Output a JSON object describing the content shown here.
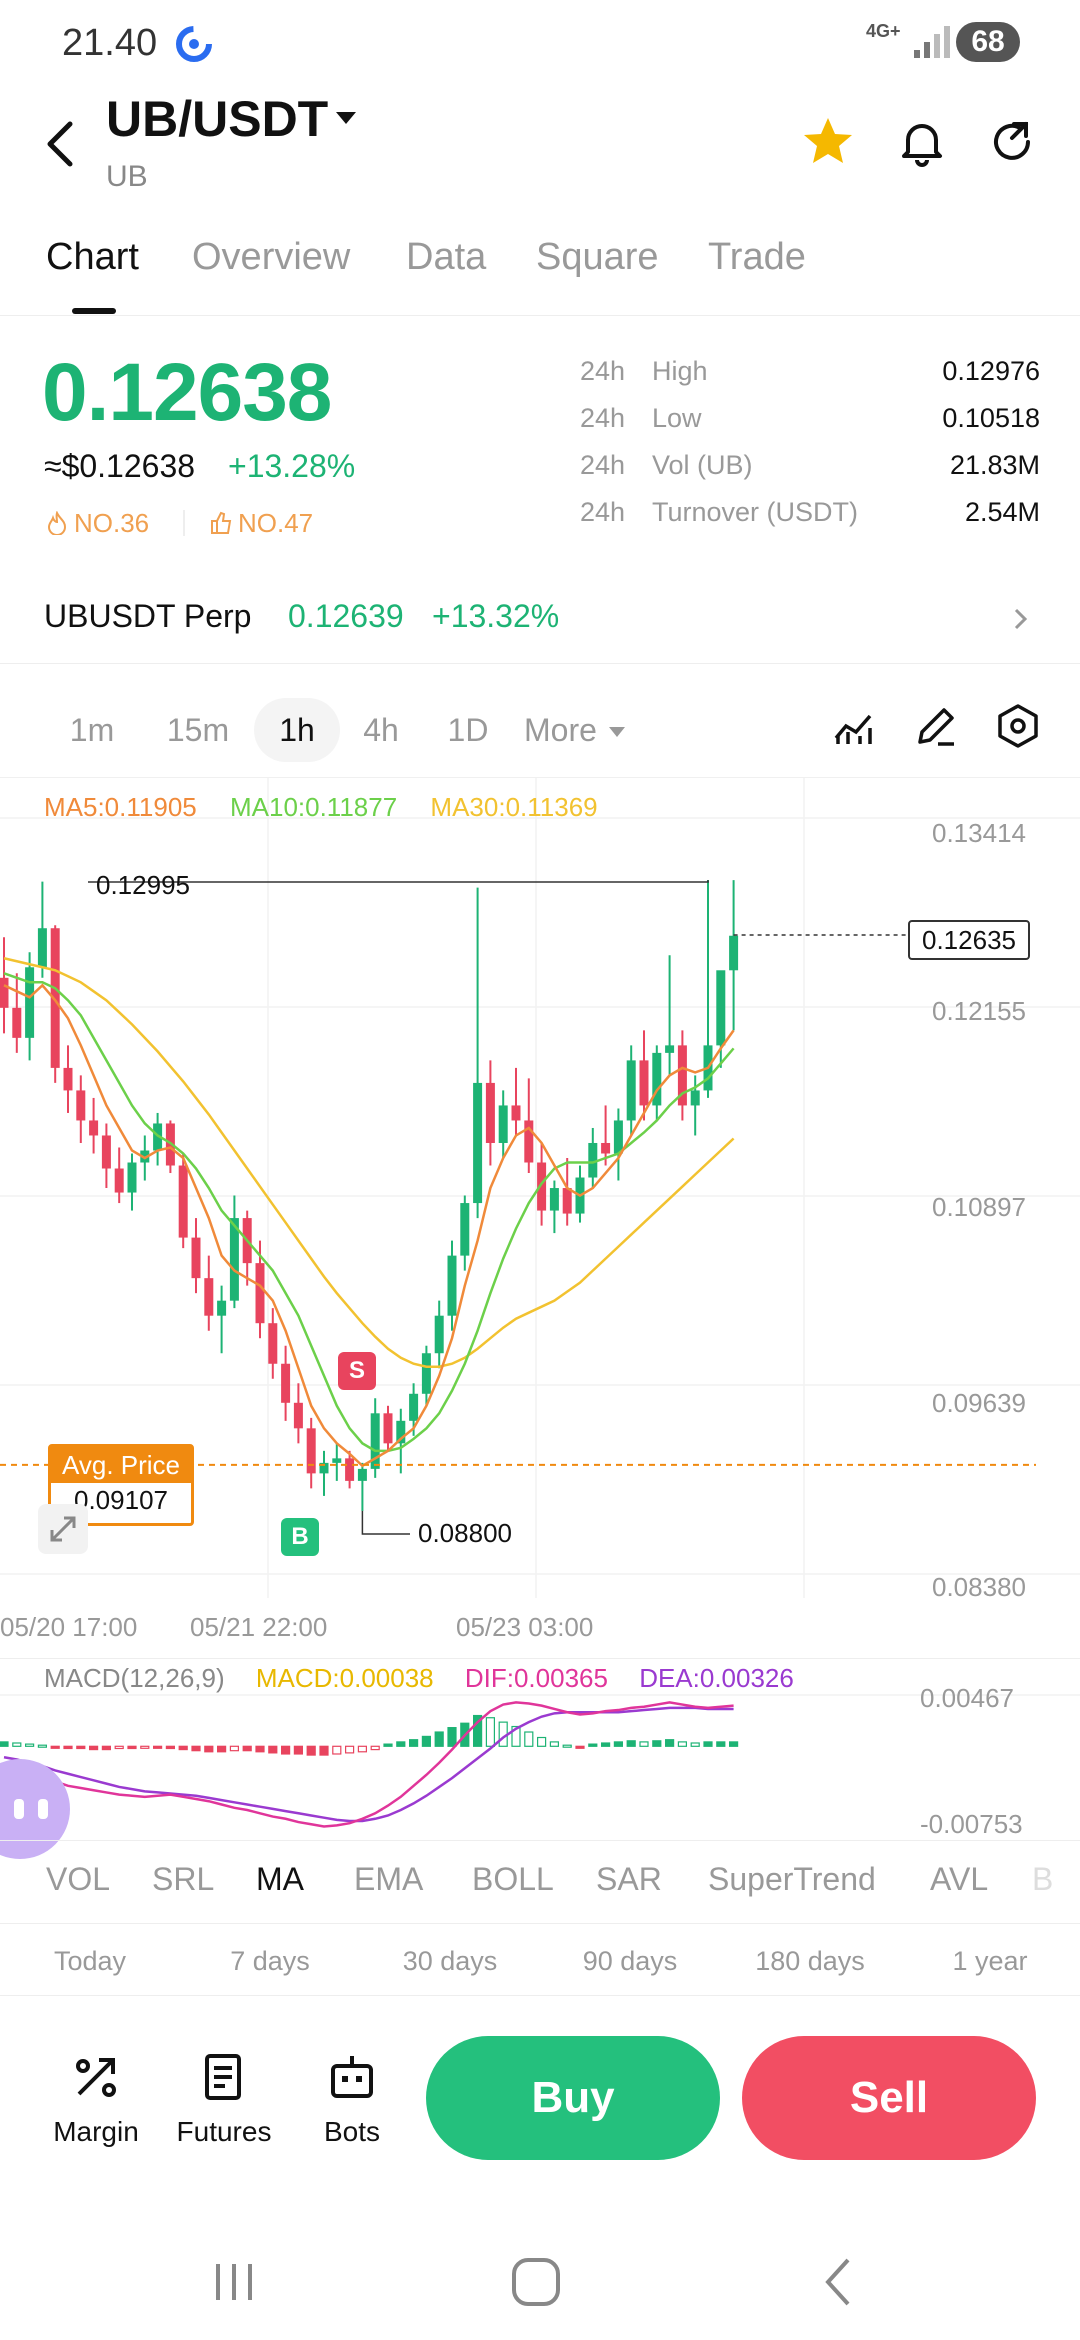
{
  "status": {
    "time": "21.40",
    "network": "4G+",
    "battery": "68"
  },
  "header": {
    "title": "UB/USDT",
    "subtitle": "UB"
  },
  "tabs": [
    "Chart",
    "Overview",
    "Data",
    "Square",
    "Trade"
  ],
  "price": {
    "last": "0.12638",
    "usd": "≈$0.12638",
    "change": "+13.28%",
    "rank_hot": "NO.36",
    "rank_gain": "NO.47"
  },
  "stats": [
    {
      "period": "24h",
      "label": "High",
      "value": "0.12976"
    },
    {
      "period": "24h",
      "label": "Low",
      "value": "0.10518"
    },
    {
      "period": "24h",
      "label": "Vol (UB)",
      "value": "21.83M"
    },
    {
      "period": "24h",
      "label": "Turnover (USDT)",
      "value": "2.54M"
    }
  ],
  "perp": {
    "name": "UBUSDT Perp",
    "price": "0.12639",
    "change": "+13.32%"
  },
  "timeframes": [
    "1m",
    "15m",
    "1h",
    "4h",
    "1D",
    "More"
  ],
  "chart_legend": {
    "ma5": "MA5:0.11905",
    "ma10": "MA10:0.11877",
    "ma30": "MA30:0.11369"
  },
  "chart_labels": {
    "y_ticks": [
      "0.13414",
      "0.12155",
      "0.10897",
      "0.09639",
      "0.08380"
    ],
    "last_price_tag": "0.12635",
    "high_marker": "0.12995",
    "low_marker": "0.08800",
    "avg_price_title": "Avg. Price",
    "avg_price_value": "0.09107",
    "sell_signal": "S",
    "buy_signal": "B",
    "x_ticks": [
      "05/20 17:00",
      "05/21 22:00",
      "05/23 03:00"
    ]
  },
  "macd": {
    "title": "MACD(12,26,9)",
    "macd": "MACD:0.00038",
    "dif": "DIF:0.00365",
    "dea": "DEA:0.00326",
    "y_ticks": [
      "0.00467",
      "-0.00753"
    ]
  },
  "indicators": [
    "VOL",
    "SRL",
    "MA",
    "EMA",
    "BOLL",
    "SAR",
    "SuperTrend",
    "AVL",
    "B"
  ],
  "ranges": [
    "Today",
    "7 days",
    "30 days",
    "90 days",
    "180 days",
    "1 year"
  ],
  "actions": {
    "margin": "Margin",
    "futures": "Futures",
    "bots": "Bots",
    "buy": "Buy",
    "sell": "Sell"
  },
  "colors": {
    "up": "#1db374",
    "down": "#e8445e",
    "ma5": "#f08a3a",
    "ma10": "#6cd04a",
    "ma30": "#f2c230",
    "avg": "#f08a10",
    "dif": "#e0359a",
    "dea": "#9a3ad0"
  },
  "chart_data": {
    "type": "candlestick",
    "interval": "1h",
    "y_range": [
      0.0838,
      0.13414
    ],
    "x_ticks": [
      "05/20 17:00",
      "05/21 22:00",
      "05/23 03:00"
    ],
    "candles": [
      [
        0.1235,
        0.1262,
        0.1198,
        0.1215
      ],
      [
        0.1215,
        0.1238,
        0.1185,
        0.1195
      ],
      [
        0.1195,
        0.1252,
        0.118,
        0.1242
      ],
      [
        0.1242,
        0.1299,
        0.1235,
        0.1268
      ],
      [
        0.1268,
        0.127,
        0.1165,
        0.1175
      ],
      [
        0.1175,
        0.119,
        0.1145,
        0.116
      ],
      [
        0.116,
        0.117,
        0.1125,
        0.114
      ],
      [
        0.114,
        0.1155,
        0.1118,
        0.113
      ],
      [
        0.113,
        0.1138,
        0.1095,
        0.1108
      ],
      [
        0.1108,
        0.1122,
        0.1085,
        0.1092
      ],
      [
        0.1092,
        0.1118,
        0.108,
        0.1112
      ],
      [
        0.1112,
        0.113,
        0.11,
        0.112
      ],
      [
        0.112,
        0.1145,
        0.111,
        0.1138
      ],
      [
        0.1138,
        0.114,
        0.1105,
        0.111
      ],
      [
        0.111,
        0.1118,
        0.1055,
        0.1062
      ],
      [
        0.1062,
        0.1075,
        0.1025,
        0.1035
      ],
      [
        0.1035,
        0.105,
        0.1,
        0.101
      ],
      [
        0.101,
        0.103,
        0.0985,
        0.102
      ],
      [
        0.102,
        0.109,
        0.1015,
        0.1075
      ],
      [
        0.1075,
        0.108,
        0.103,
        0.1045
      ],
      [
        0.1045,
        0.106,
        0.0995,
        0.1005
      ],
      [
        0.1005,
        0.1015,
        0.0968,
        0.0978
      ],
      [
        0.0978,
        0.099,
        0.094,
        0.0952
      ],
      [
        0.0952,
        0.0965,
        0.0925,
        0.0935
      ],
      [
        0.0935,
        0.0942,
        0.0895,
        0.0905
      ],
      [
        0.0905,
        0.092,
        0.089,
        0.0912
      ],
      [
        0.0912,
        0.0925,
        0.09,
        0.0915
      ],
      [
        0.0915,
        0.092,
        0.0895,
        0.09
      ],
      [
        0.09,
        0.0912,
        0.088,
        0.0908
      ],
      [
        0.0908,
        0.0955,
        0.0902,
        0.0945
      ],
      [
        0.0945,
        0.095,
        0.092,
        0.0925
      ],
      [
        0.0925,
        0.0948,
        0.0905,
        0.094
      ],
      [
        0.094,
        0.0965,
        0.093,
        0.0958
      ],
      [
        0.0958,
        0.099,
        0.095,
        0.0985
      ],
      [
        0.0985,
        0.102,
        0.0975,
        0.101
      ],
      [
        0.101,
        0.106,
        0.1,
        0.105
      ],
      [
        0.105,
        0.109,
        0.104,
        0.1085
      ],
      [
        0.1085,
        0.1295,
        0.1075,
        0.1165
      ],
      [
        0.1165,
        0.118,
        0.111,
        0.1125
      ],
      [
        0.1125,
        0.116,
        0.1115,
        0.115
      ],
      [
        0.115,
        0.1175,
        0.113,
        0.114
      ],
      [
        0.114,
        0.1168,
        0.1105,
        0.1112
      ],
      [
        0.1112,
        0.1125,
        0.107,
        0.108
      ],
      [
        0.108,
        0.11,
        0.1065,
        0.1095
      ],
      [
        0.1095,
        0.1115,
        0.107,
        0.1078
      ],
      [
        0.1078,
        0.111,
        0.1072,
        0.1102
      ],
      [
        0.1102,
        0.1135,
        0.1095,
        0.1125
      ],
      [
        0.1125,
        0.115,
        0.111,
        0.1118
      ],
      [
        0.1118,
        0.1148,
        0.11,
        0.114
      ],
      [
        0.114,
        0.119,
        0.113,
        0.118
      ],
      [
        0.118,
        0.12,
        0.114,
        0.115
      ],
      [
        0.115,
        0.119,
        0.114,
        0.1185
      ],
      [
        0.1185,
        0.125,
        0.117,
        0.119
      ],
      [
        0.119,
        0.12,
        0.114,
        0.115
      ],
      [
        0.115,
        0.117,
        0.113,
        0.116
      ],
      [
        0.116,
        0.13,
        0.1155,
        0.119
      ],
      [
        0.119,
        0.123,
        0.1175,
        0.124
      ],
      [
        0.124,
        0.13,
        0.12,
        0.1263
      ]
    ],
    "ma5": [
      0.123,
      0.1226,
      0.1222,
      0.123,
      0.122,
      0.1208,
      0.119,
      0.117,
      0.115,
      0.1135,
      0.112,
      0.1115,
      0.112,
      0.1122,
      0.1115,
      0.1095,
      0.1075,
      0.105,
      0.104,
      0.1035,
      0.103,
      0.102,
      0.1,
      0.0975,
      0.095,
      0.0935,
      0.0925,
      0.0918,
      0.091,
      0.0915,
      0.092,
      0.0928,
      0.0935,
      0.095,
      0.097,
      0.0995,
      0.103,
      0.106,
      0.1095,
      0.1115,
      0.113,
      0.1135,
      0.1125,
      0.111,
      0.1095,
      0.109,
      0.1095,
      0.1105,
      0.1115,
      0.113,
      0.1145,
      0.116,
      0.117,
      0.1175,
      0.1172,
      0.1175,
      0.1188,
      0.12
    ],
    "ma10": [
      0.1238,
      0.1235,
      0.1232,
      0.1232,
      0.1228,
      0.122,
      0.121,
      0.1195,
      0.118,
      0.1165,
      0.115,
      0.1138,
      0.113,
      0.1125,
      0.1118,
      0.1108,
      0.1095,
      0.108,
      0.107,
      0.106,
      0.105,
      0.104,
      0.1025,
      0.101,
      0.099,
      0.097,
      0.095,
      0.0935,
      0.0925,
      0.092,
      0.092,
      0.0922,
      0.0928,
      0.0935,
      0.0945,
      0.096,
      0.0978,
      0.1,
      0.1025,
      0.1048,
      0.1068,
      0.1085,
      0.1098,
      0.1108,
      0.1112,
      0.1112,
      0.1112,
      0.1115,
      0.1118,
      0.1125,
      0.1132,
      0.114,
      0.115,
      0.1158,
      0.1162,
      0.1168,
      0.1178,
      0.1188
    ],
    "ma30": [
      0.1248,
      0.1246,
      0.1244,
      0.1242,
      0.124,
      0.1236,
      0.1232,
      0.1226,
      0.122,
      0.1212,
      0.1204,
      0.1195,
      0.1186,
      0.1176,
      0.1166,
      0.1155,
      0.1144,
      0.1132,
      0.112,
      0.1108,
      0.1096,
      0.1084,
      0.1072,
      0.106,
      0.1048,
      0.1036,
      0.1025,
      0.1015,
      0.1005,
      0.0996,
      0.0988,
      0.0982,
      0.0978,
      0.0976,
      0.0976,
      0.0978,
      0.0982,
      0.0988,
      0.0995,
      0.1002,
      0.1008,
      0.1012,
      0.1016,
      0.102,
      0.1026,
      0.1032,
      0.104,
      0.1048,
      0.1056,
      0.1064,
      0.1072,
      0.108,
      0.1088,
      0.1096,
      0.1104,
      0.1112,
      0.112,
      0.1128
    ],
    "last_price": 0.12635,
    "avg_price": 0.09107,
    "macd_range": [
      -0.00753,
      0.00467
    ],
    "macd_hist": [
      0.0004,
      0.0003,
      0.0002,
      0.0001,
      -0.0001,
      -0.0002,
      -0.0002,
      -0.0003,
      -0.0003,
      -0.0002,
      -0.0002,
      -0.0001,
      -0.0001,
      -0.0002,
      -0.0003,
      -0.0004,
      -0.0005,
      -0.0005,
      -0.0004,
      -0.0004,
      -0.0005,
      -0.0006,
      -0.0007,
      -0.0007,
      -0.0008,
      -0.0008,
      -0.0007,
      -0.0006,
      -0.0005,
      -0.0003,
      0.0002,
      0.0004,
      0.0006,
      0.0009,
      0.0013,
      0.0017,
      0.0021,
      0.0028,
      0.0026,
      0.0022,
      0.0018,
      0.0013,
      0.0008,
      0.0004,
      0.0001,
      -0.0001,
      0.0002,
      0.0003,
      0.0004,
      0.0005,
      0.0004,
      0.0005,
      0.0006,
      0.0004,
      0.0003,
      0.0004,
      0.0004,
      0.0004
    ],
    "dif": [
      -0.0018,
      -0.002,
      -0.0024,
      -0.0028,
      -0.0032,
      -0.0036,
      -0.0038,
      -0.004,
      -0.0042,
      -0.0044,
      -0.0045,
      -0.0046,
      -0.0045,
      -0.0044,
      -0.0046,
      -0.0048,
      -0.005,
      -0.0053,
      -0.0056,
      -0.0058,
      -0.0061,
      -0.0064,
      -0.0066,
      -0.0069,
      -0.0071,
      -0.0073,
      -0.0072,
      -0.007,
      -0.0066,
      -0.0061,
      -0.0054,
      -0.0046,
      -0.0036,
      -0.0026,
      -0.0015,
      -0.0003,
      0.001,
      0.0022,
      0.0032,
      0.0038,
      0.004,
      0.0039,
      0.0037,
      0.0034,
      0.0031,
      0.0029,
      0.003,
      0.0032,
      0.0033,
      0.0035,
      0.0036,
      0.0038,
      0.004,
      0.0038,
      0.0036,
      0.0035,
      0.0036,
      0.0037
    ],
    "dea": [
      -0.001,
      -0.0012,
      -0.0015,
      -0.0018,
      -0.0022,
      -0.0025,
      -0.0028,
      -0.0031,
      -0.0034,
      -0.0037,
      -0.0039,
      -0.0041,
      -0.0042,
      -0.0043,
      -0.0044,
      -0.0045,
      -0.0047,
      -0.0049,
      -0.0051,
      -0.0053,
      -0.0055,
      -0.0057,
      -0.0059,
      -0.0061,
      -0.0063,
      -0.0065,
      -0.0067,
      -0.0068,
      -0.0068,
      -0.0066,
      -0.0063,
      -0.0058,
      -0.0052,
      -0.0045,
      -0.0037,
      -0.0029,
      -0.002,
      -0.0011,
      -0.0002,
      0.0008,
      0.0016,
      0.0022,
      0.0027,
      0.003,
      0.0031,
      0.0031,
      0.0031,
      0.0031,
      0.0031,
      0.0032,
      0.0033,
      0.0034,
      0.0035,
      0.0035,
      0.0035,
      0.0034,
      0.0034,
      0.0034
    ]
  }
}
